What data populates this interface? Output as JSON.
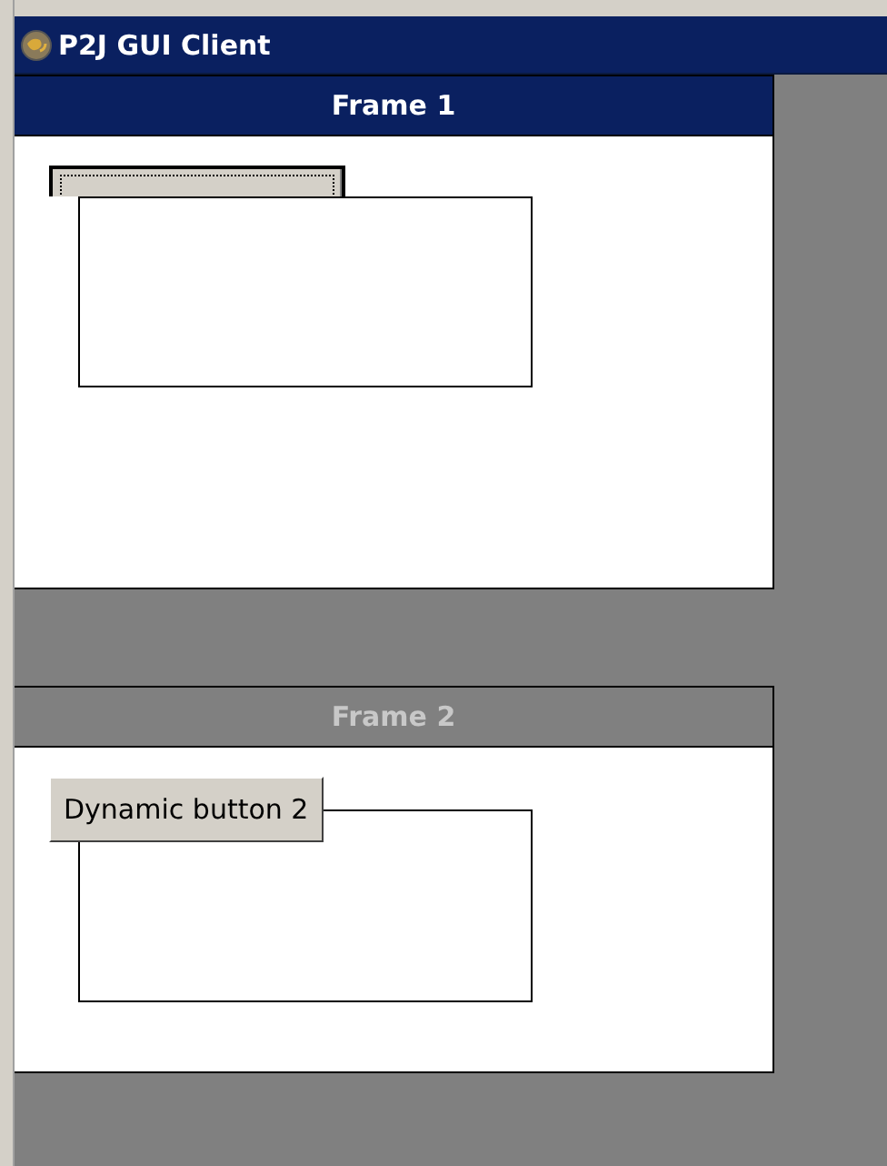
{
  "window": {
    "title": "P2J GUI Client"
  },
  "frames": [
    {
      "title": "Frame 1",
      "active": true,
      "button": {
        "focused": true
      }
    },
    {
      "title": "Frame 2",
      "active": false,
      "button": {
        "label": "Dynamic button 2",
        "focused": false
      }
    }
  ]
}
